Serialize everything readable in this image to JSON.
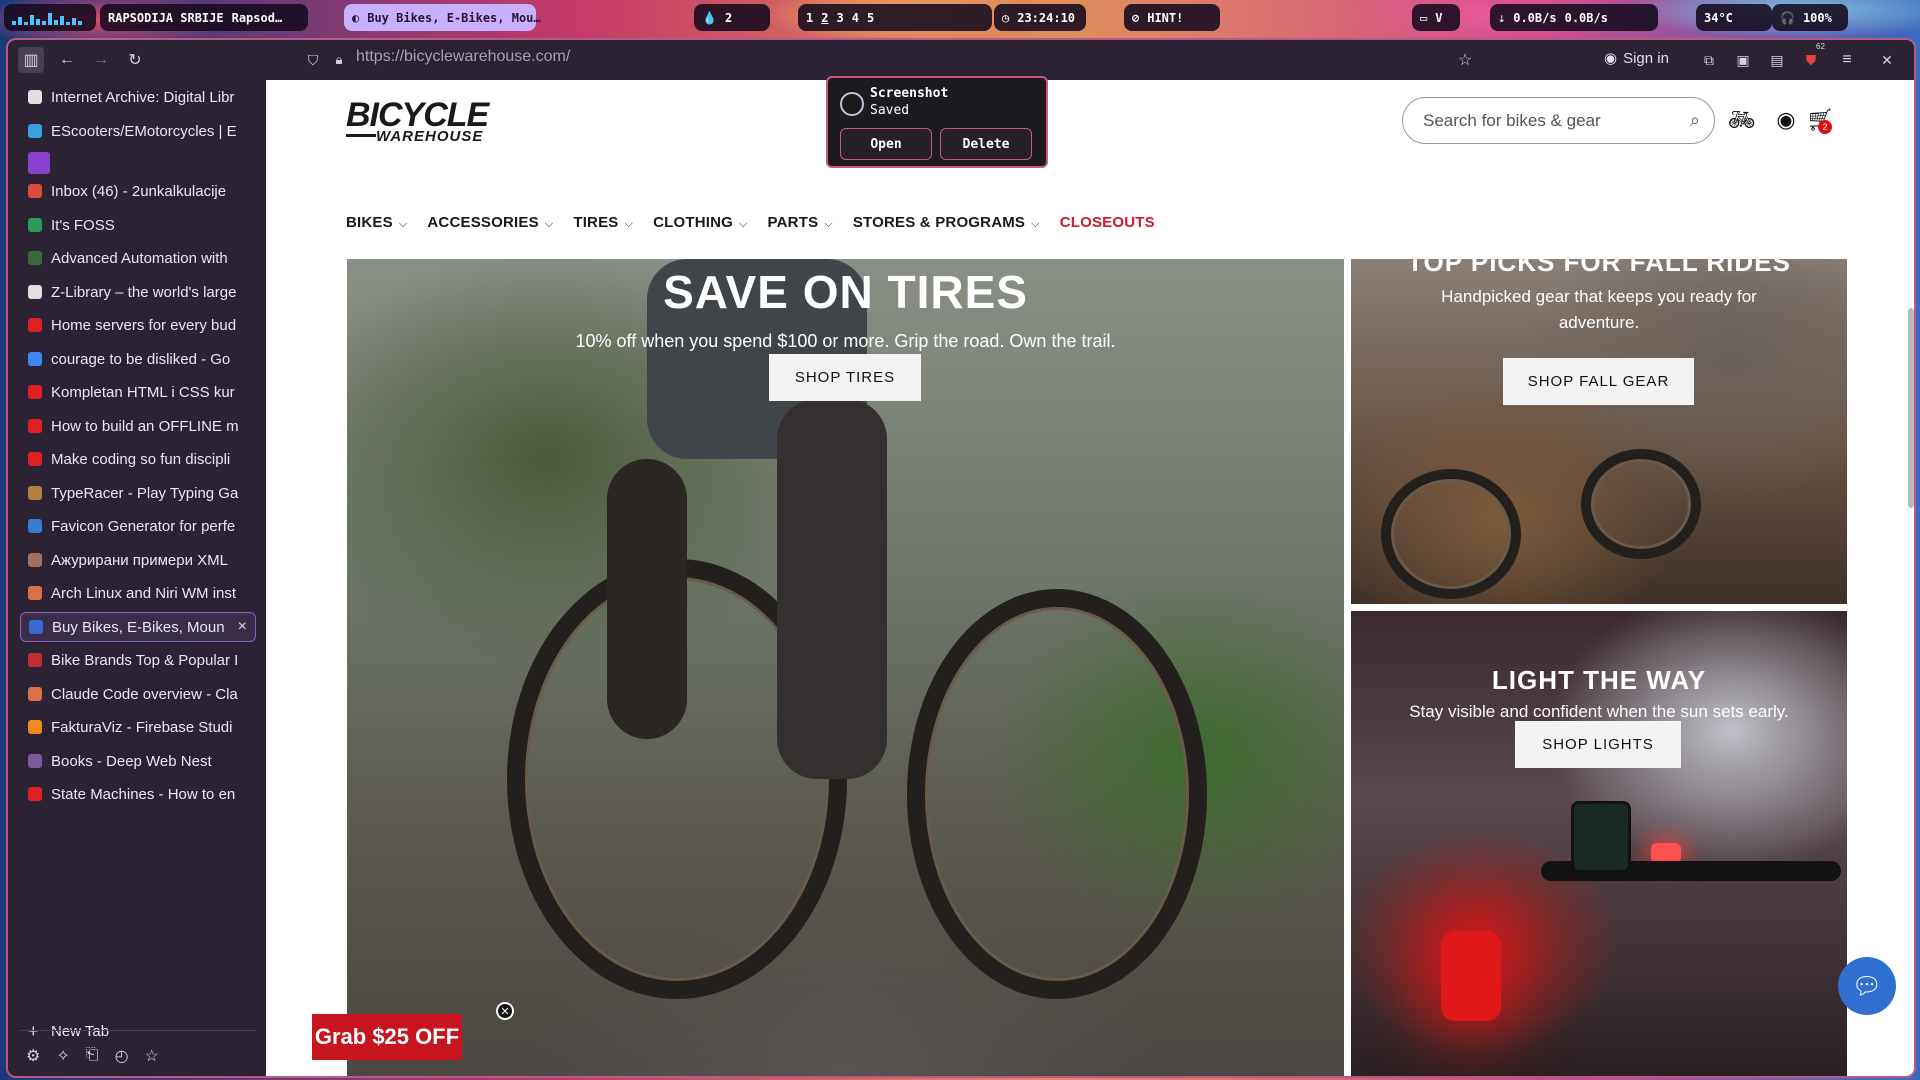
{
  "waybar": {
    "media_title": "RAPSODIJA SRBIJE",
    "media_artist": "Rapsod…",
    "active_window": "Buy Bikes, E-Bikes, Mou…",
    "ws_count": "2",
    "workspaces": [
      "1",
      "2",
      "3",
      "4",
      "5"
    ],
    "clock": "23:24:10",
    "hint": "HINT!",
    "net_down": "0.0B/s",
    "net_up": "0.0B/s",
    "temp": "34°C",
    "battery": "100%"
  },
  "browser": {
    "url": "https://bicyclewarehouse.com/",
    "sign_in": "Sign in",
    "ext_badge": "62"
  },
  "sidebar": {
    "tabs": [
      {
        "title": "Internet Archive: Digital Libr",
        "icon": "archive-icon",
        "color": "#e0e0e0"
      },
      {
        "title": "EScooters/EMotorcycles | E",
        "icon": "globe-icon",
        "color": "#3aa0e0"
      },
      {
        "title": "",
        "icon": "purple-square-icon",
        "color": "#8a3fd0"
      },
      {
        "title": "Inbox (46) - 2unkalkulacije",
        "icon": "gmail-icon",
        "color": "#d94b3b"
      },
      {
        "title": "It's FOSS",
        "icon": "itsfoss-icon",
        "color": "#2a9a5a"
      },
      {
        "title": "Advanced Automation with",
        "icon": "robot-icon",
        "color": "#3a6a3a"
      },
      {
        "title": "Z-Library – the world's large",
        "icon": "zlib-icon",
        "color": "#e0e0e0"
      },
      {
        "title": "Home servers for every bud",
        "icon": "youtube-icon",
        "color": "#e02020"
      },
      {
        "title": "courage to be disliked - Go",
        "icon": "google-icon",
        "color": "#4285f4"
      },
      {
        "title": "Kompletan HTML i CSS kur",
        "icon": "youtube-icon",
        "color": "#e02020"
      },
      {
        "title": "How to build an OFFLINE m",
        "icon": "youtube-icon",
        "color": "#e02020"
      },
      {
        "title": "Make coding so fun discipli",
        "icon": "youtube-icon",
        "color": "#e02020"
      },
      {
        "title": "TypeRacer - Play Typing Ga",
        "icon": "typeracer-icon",
        "color": "#b08040"
      },
      {
        "title": "Favicon Generator for perfe",
        "icon": "favicon-gen-icon",
        "color": "#3a7ad0"
      },
      {
        "title": "Ажурирани примери XML",
        "icon": "image-icon",
        "color": "#a07060"
      },
      {
        "title": "Arch Linux and Niri WM inst",
        "icon": "claude-icon",
        "color": "#d8704a"
      },
      {
        "title": "Buy Bikes, E-Bikes, Moun",
        "icon": "bicycle-warehouse-icon",
        "color": "#3a6ad0"
      },
      {
        "title": "Bike Brands Top & Popular I",
        "icon": "bike-brand-icon",
        "color": "#c03030"
      },
      {
        "title": "Claude Code overview - Cla",
        "icon": "claude-icon",
        "color": "#d8704a"
      },
      {
        "title": "FakturaViz - Firebase Studi",
        "icon": "firebase-icon",
        "color": "#f08a20"
      },
      {
        "title": "Books - Deep Web Nest",
        "icon": "books-icon",
        "color": "#7a5a9a"
      },
      {
        "title": "State Machines - How to en",
        "icon": "youtube-icon",
        "color": "#e02020"
      }
    ],
    "new_tab": "New Tab"
  },
  "site": {
    "logo_top": "BICYCLE",
    "logo_bottom": "WAREHOUSE",
    "search_placeholder": "Search for bikes & gear",
    "cart_count": "2",
    "nav": [
      "BIKES",
      "ACCESSORIES",
      "TIRES",
      "CLOTHING",
      "PARTS",
      "STORES & PROGRAMS"
    ],
    "nav_closeouts": "CLOSEOUTS",
    "hero_title": "SAVE ON TIRES",
    "hero_sub": "10% off when you spend $100 or more. Grip the road. Own the trail.",
    "hero_cta": "SHOP TIRES",
    "card1_title": "TOP PICKS FOR FALL RIDES",
    "card1_sub": "Handpicked gear that keeps you ready for adventure.",
    "card1_cta": "SHOP FALL GEAR",
    "card2_title": "LIGHT THE WAY",
    "card2_sub": "Stay visible and confident when the sun sets early.",
    "card2_cta": "SHOP LIGHTS",
    "promo": "Grab $25 OFF"
  },
  "notification": {
    "title": "Screenshot",
    "subtitle": "Saved",
    "open_label": "Open",
    "delete_label": "Delete"
  }
}
